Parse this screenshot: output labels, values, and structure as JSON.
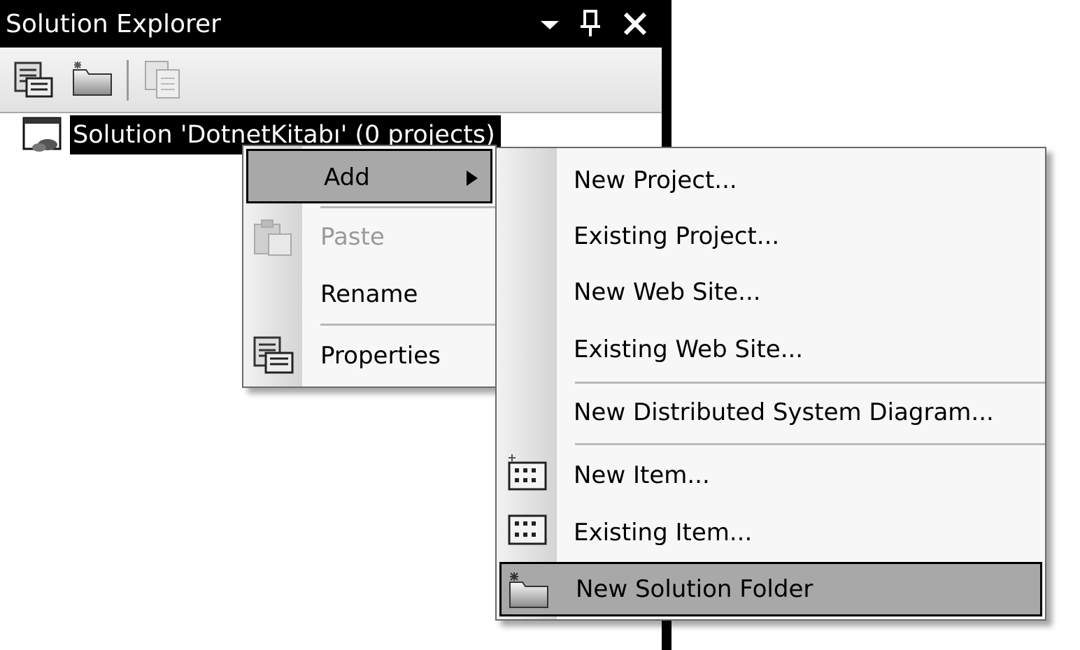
{
  "window": {
    "title": "Solution Explorer",
    "buttons": {
      "dropdown_icon": "chevron-down-icon",
      "pin_icon": "pin-icon",
      "close_icon": "close-icon"
    }
  },
  "toolbar": {
    "buttons": [
      {
        "icon": "properties-icon"
      },
      {
        "icon": "new-folder-icon"
      },
      {
        "icon": "copy-icon"
      }
    ]
  },
  "tree": {
    "solution_label": "Solution 'DotnetKitabı' (0 projects)",
    "icon": "solution-icon"
  },
  "context_menu": {
    "items": [
      {
        "label": "Add",
        "state": "highlighted",
        "has_submenu": true
      },
      {
        "label": "Paste",
        "state": "disabled",
        "icon": "paste-icon"
      },
      {
        "label": "Rename",
        "state": "normal"
      },
      {
        "label": "Properties",
        "state": "normal",
        "icon": "properties-icon"
      }
    ]
  },
  "submenu": {
    "items": [
      {
        "label": "New Project..."
      },
      {
        "label": "Existing Project..."
      },
      {
        "label": "New Web Site..."
      },
      {
        "label": "Existing Web Site..."
      },
      {
        "label": "New Distributed System Diagram..."
      },
      {
        "label": "New Item...",
        "icon": "new-item-icon"
      },
      {
        "label": "Existing Item...",
        "icon": "existing-item-icon"
      },
      {
        "label": "New Solution Folder",
        "icon": "new-folder-icon",
        "state": "highlighted"
      }
    ]
  },
  "colors": {
    "titlebar": "#000000",
    "highlight": "#a8a8a8",
    "menu_bg": "#f7f7f7"
  }
}
